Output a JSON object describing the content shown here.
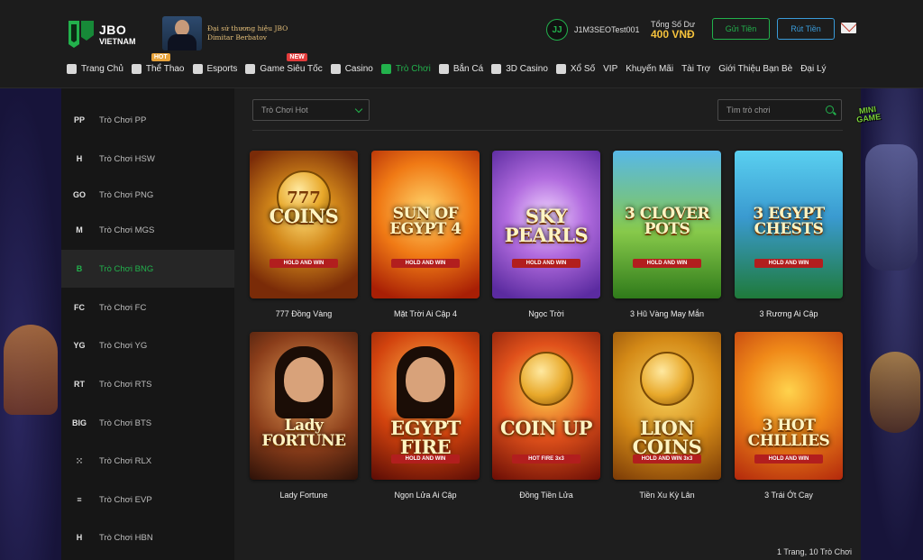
{
  "brand": {
    "line1": "JBO",
    "line2": "VIETNAM"
  },
  "ambassador": {
    "line1": "Đại sứ thương hiệu JBO",
    "line2": "Dimitar Berbatov"
  },
  "user": {
    "name": "J1M3SEOTest001"
  },
  "balance": {
    "label": "Tổng Số Dư",
    "value": "400 VNĐ"
  },
  "actions": {
    "deposit": "Gửi Tiền",
    "withdraw": "Rút Tiền"
  },
  "nav": [
    {
      "label": "Trang Chủ",
      "icon": "home-icon"
    },
    {
      "label": "Thể Thao",
      "icon": "soccer-ball-icon",
      "badge": "HOT"
    },
    {
      "label": "Esports",
      "icon": "gamepad-icon"
    },
    {
      "label": "Game Siêu Tốc",
      "icon": "controller-icon",
      "badge": "NEW"
    },
    {
      "label": "Casino",
      "icon": "cards-icon"
    },
    {
      "label": "Trò Chơi",
      "icon": "slot-machine-icon",
      "active": true
    },
    {
      "label": "Bắn Cá",
      "icon": "fish-icon"
    },
    {
      "label": "3D Casino",
      "icon": "dice-icon"
    },
    {
      "label": "Xổ Số",
      "icon": "lottery-ball-icon"
    },
    {
      "label": "VIP"
    },
    {
      "label": "Khuyến Mãi"
    },
    {
      "label": "Tài Trợ"
    },
    {
      "label": "Giới Thiệu Bạn Bè"
    },
    {
      "label": "Đại Lý"
    }
  ],
  "sidebar": {
    "items": [
      {
        "label": "Trò Chơi PP",
        "icon": "pp-logo-icon",
        "glyph": "PP"
      },
      {
        "label": "Trò Chơi HSW",
        "icon": "hsw-logo-icon",
        "glyph": "H"
      },
      {
        "label": "Trò Chơi PNG",
        "icon": "png-logo-icon",
        "glyph": "GO"
      },
      {
        "label": "Trò Chơi MGS",
        "icon": "mgs-logo-icon",
        "glyph": "M"
      },
      {
        "label": "Trò Chơi BNG",
        "icon": "bng-logo-icon",
        "glyph": "B",
        "active": true
      },
      {
        "label": "Trò Chơi FC",
        "icon": "fc-logo-icon",
        "glyph": "FC"
      },
      {
        "label": "Trò Chơi YG",
        "icon": "yg-logo-icon",
        "glyph": "YG"
      },
      {
        "label": "Trò Chơi RTS",
        "icon": "rts-logo-icon",
        "glyph": "RT"
      },
      {
        "label": "Trò Chơi BTS",
        "icon": "bts-logo-icon",
        "glyph": "BIG"
      },
      {
        "label": "Trò Chơi RLX",
        "icon": "rlx-logo-icon",
        "glyph": "⁙"
      },
      {
        "label": "Trò Chơi EVP",
        "icon": "evp-logo-icon",
        "glyph": "≡"
      },
      {
        "label": "Trò Chơi HBN",
        "icon": "hbn-logo-icon",
        "glyph": "H"
      }
    ]
  },
  "filter": {
    "selected": "Trò Chơi Hot"
  },
  "search": {
    "placeholder": "Tìm trò chơi"
  },
  "minigame": {
    "line1": "MINI",
    "line2": "GAME"
  },
  "games": [
    {
      "name": "777 Đồng Vàng",
      "art_title": "COINS",
      "art_sub": "HOLD AND WIN",
      "art_top": "777"
    },
    {
      "name": "Mặt Trời Ai Cập 4",
      "art_title": "SUN OF EGYPT 4",
      "art_sub": "HOLD AND WIN"
    },
    {
      "name": "Ngọc Trời",
      "art_title": "SKY PEARLS",
      "art_sub": "HOLD AND WIN"
    },
    {
      "name": "3 Hũ Vàng May Mắn",
      "art_title": "3 CLOVER POTS",
      "art_sub": "HOLD AND WIN"
    },
    {
      "name": "3 Rương Ai Cập",
      "art_title": "3 EGYPT CHESTS",
      "art_sub": "HOLD AND WIN"
    },
    {
      "name": "Lady Fortune",
      "art_title": "Lady FORTUNE",
      "art_sub": ""
    },
    {
      "name": "Ngọn Lửa Ai Cập",
      "art_title": "EGYPT FIRE",
      "art_sub": "HOLD AND WIN"
    },
    {
      "name": "Đồng Tiền Lửa",
      "art_title": "COIN UP",
      "art_sub": "HOT FIRE 3x3"
    },
    {
      "name": "Tiền Xu Kỳ Lân",
      "art_title": "LION COINS",
      "art_sub": "HOLD AND WIN 3x3"
    },
    {
      "name": "3 Trái Ớt Cay",
      "art_title": "3 HOT CHILLIES",
      "art_sub": "HOLD AND WIN"
    }
  ],
  "pagination": {
    "text": "1 Trang,  10 Trò Chơi"
  }
}
